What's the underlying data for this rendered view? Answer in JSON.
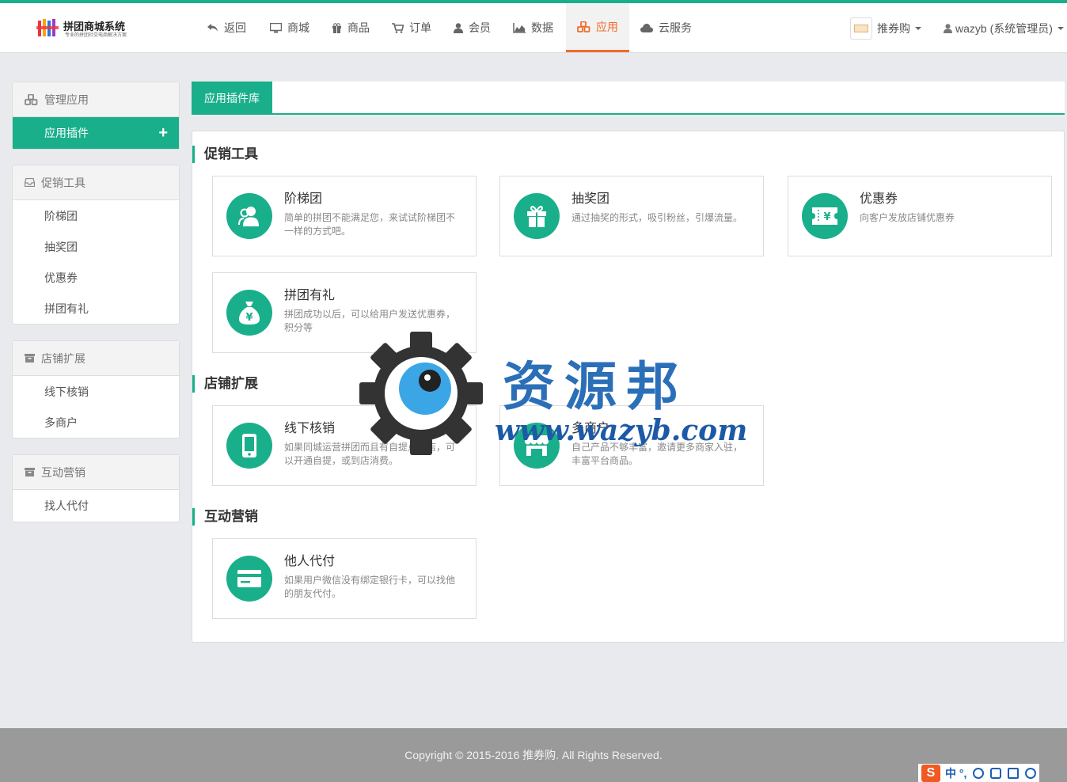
{
  "logo": {
    "name": "拼团商城系统",
    "slogan": "专业的拼团社交电商解决方案"
  },
  "nav": {
    "items": [
      {
        "label": "返回",
        "icon": "reply-icon"
      },
      {
        "label": "商城",
        "icon": "monitor-icon"
      },
      {
        "label": "商品",
        "icon": "gift-icon"
      },
      {
        "label": "订单",
        "icon": "cart-icon"
      },
      {
        "label": "会员",
        "icon": "user-icon"
      },
      {
        "label": "数据",
        "icon": "area-chart-icon"
      },
      {
        "label": "应用",
        "icon": "cubes-icon",
        "active": true
      },
      {
        "label": "云服务",
        "icon": "cloud-icon"
      }
    ],
    "brand_label": "推券购",
    "user_label": "wazyb (系统管理员)"
  },
  "sidebar": {
    "manage": {
      "title": "管理应用",
      "active_item": "应用插件",
      "plus": "+"
    },
    "groups": [
      {
        "title": "促销工具",
        "items": [
          "阶梯团",
          "抽奖团",
          "优惠券",
          "拼团有礼"
        ]
      },
      {
        "title": "店铺扩展",
        "items": [
          "线下核销",
          "多商户"
        ]
      },
      {
        "title": "互动营销",
        "items": [
          "找人代付"
        ]
      }
    ]
  },
  "main": {
    "tab": "应用插件库",
    "sections": [
      {
        "title": "促销工具",
        "cards": [
          {
            "title": "阶梯团",
            "desc": "简单的拼团不能满足您，来试试阶梯团不一样的方式吧。",
            "icon": "users-icon"
          },
          {
            "title": "抽奖团",
            "desc": "通过抽奖的形式，吸引粉丝，引爆流量。",
            "icon": "gift-icon"
          },
          {
            "title": "优惠券",
            "desc": "向客户发放店铺优惠券",
            "icon": "ticket-icon"
          },
          {
            "title": "拼团有礼",
            "desc": "拼团成功以后，可以给用户发送优惠券，积分等",
            "icon": "money-bag-icon"
          }
        ]
      },
      {
        "title": "店铺扩展",
        "cards": [
          {
            "title": "线下核销",
            "desc": "如果同城运营拼团而且有自提点商店，可以开通自提，或到店消费。",
            "icon": "mobile-icon"
          },
          {
            "title": "多商户",
            "desc": "自己产品不够丰富，邀请更多商家入驻，丰富平台商品。",
            "icon": "store-icon"
          }
        ]
      },
      {
        "title": "互动营销",
        "cards": [
          {
            "title": "他人代付",
            "desc": "如果用户微信没有绑定银行卡，可以找他的朋友代付。",
            "icon": "credit-card-icon"
          }
        ]
      }
    ]
  },
  "watermark": {
    "cn": "资源邦",
    "url": "www.wazyb.com"
  },
  "footer": {
    "copyright": "Copyright © 2015-2016 推券购. All Rights Reserved."
  },
  "ime": {
    "label": "中 °,"
  },
  "colors": {
    "accent": "#1aaf8b",
    "active_nav": "#f06b2c",
    "footer": "#9a9a9a"
  }
}
